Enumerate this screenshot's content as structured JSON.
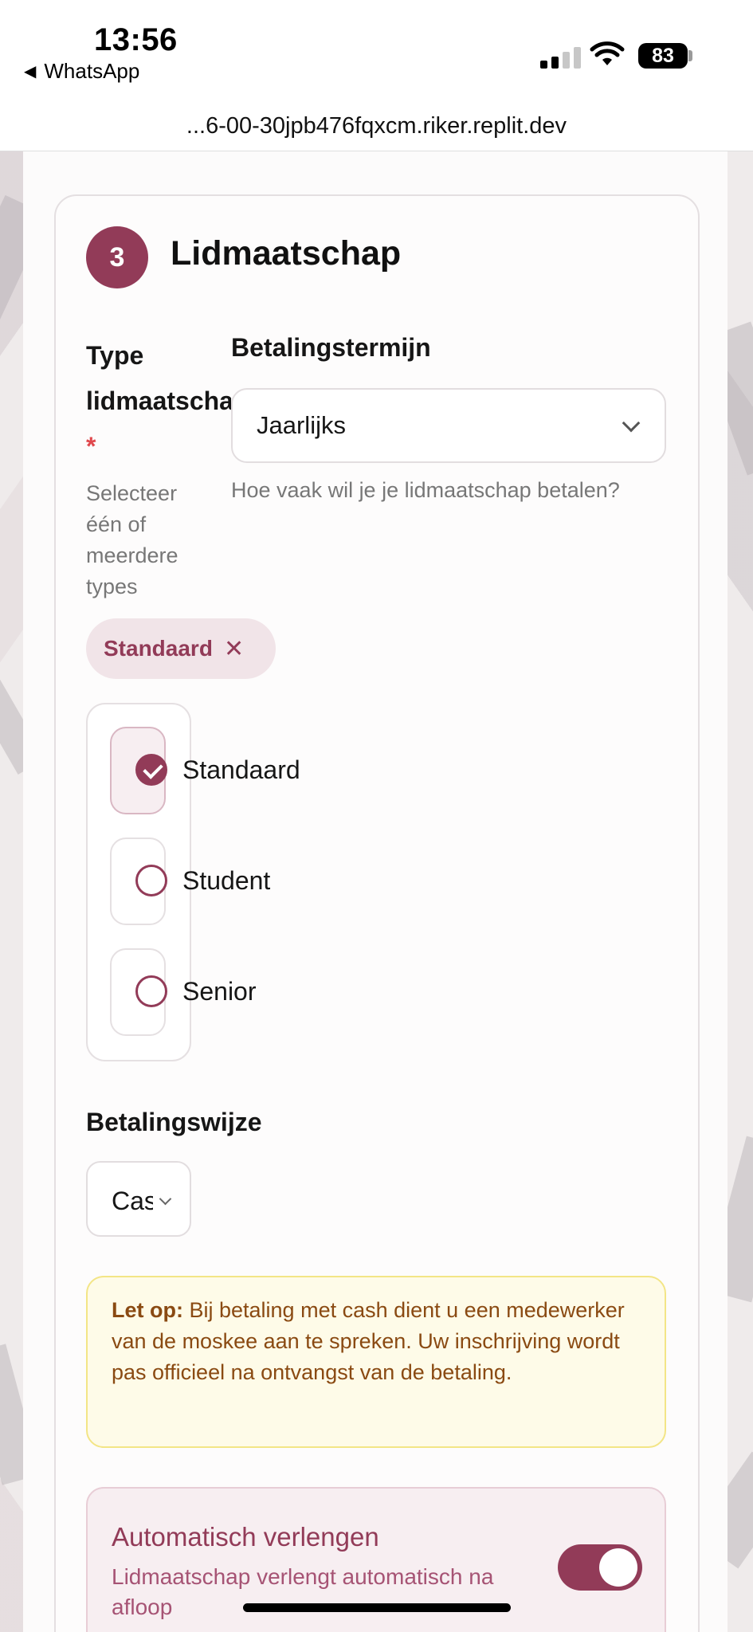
{
  "status_bar": {
    "time": "13:56",
    "back_app": "WhatsApp",
    "battery": "83"
  },
  "browser": {
    "url": "...6-00-30jpb476fqxcm.riker.replit.dev"
  },
  "section": {
    "step_number": "3",
    "title": "Lidmaatschap"
  },
  "membership_type": {
    "label": "Type lidmaatschap",
    "required_mark": "*",
    "help": "Selecteer één of meerdere types",
    "selected_chip": "Standaard",
    "chip_remove": "✕",
    "options": [
      {
        "label": "Standaard",
        "checked": true
      },
      {
        "label": "Student",
        "checked": false
      },
      {
        "label": "Senior",
        "checked": false
      }
    ]
  },
  "payment_term": {
    "label": "Betalingstermijn",
    "value": "Jaarlijks",
    "help": "Hoe vaak wil je je lidmaatschap betalen?"
  },
  "payment_method": {
    "label": "Betalingswijze",
    "value": "Cash"
  },
  "notice": {
    "bold": "Let op:",
    "text": " Bij betaling met cash dient u een medewerker van de moskee aan te spreken. Uw inschrijving wordt pas officieel na ontvangst van de betaling."
  },
  "auto_renew": {
    "title": "Automatisch verlengen",
    "description": "Lidmaatschap verlengt automatisch na afloop",
    "enabled": true
  },
  "colors": {
    "accent": "#923b58",
    "notice_bg": "#fefbe8",
    "notice_text": "#8a4a12"
  }
}
